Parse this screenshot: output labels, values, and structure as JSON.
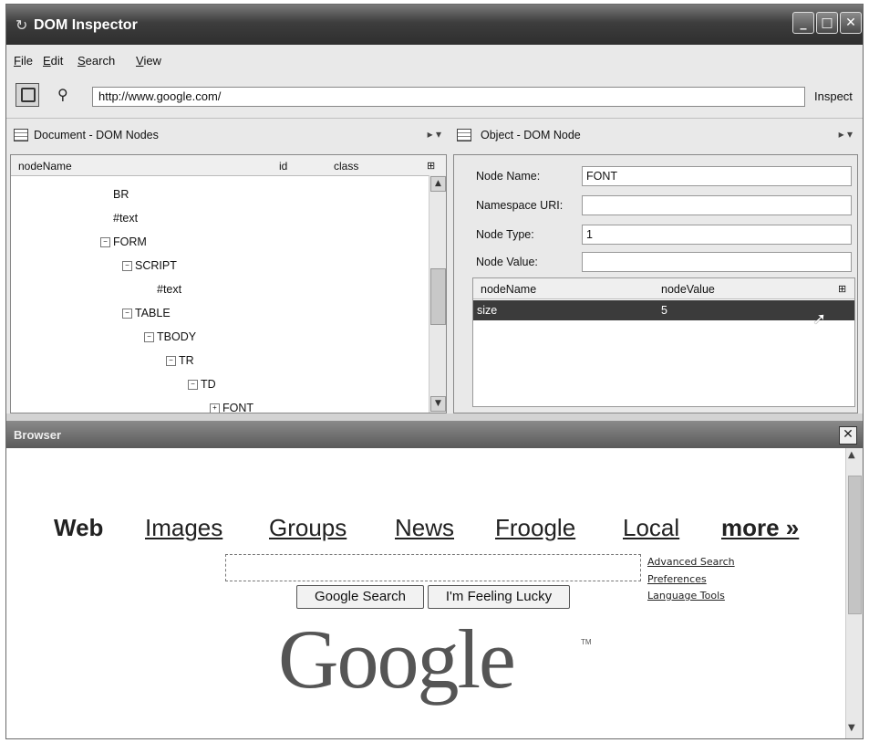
{
  "window": {
    "title": "DOM Inspector",
    "title_icon": "refresh-icon",
    "buttons": [
      "minimize",
      "maximize",
      "close"
    ]
  },
  "menu": [
    {
      "key": "F",
      "rest": "ile"
    },
    {
      "key": "E",
      "rest": "dit"
    },
    {
      "key": "S",
      "rest": "earch"
    },
    {
      "key": "V",
      "rest": "iew"
    }
  ],
  "toolbar": {
    "url": "http://www.google.com/",
    "inspect_label": "Inspect"
  },
  "left_pane": {
    "title": "Document - DOM Nodes",
    "columns": [
      "nodeName",
      "id",
      "class"
    ],
    "nodes": [
      {
        "label": "BR",
        "toggle": ""
      },
      {
        "label": "#text",
        "toggle": ""
      },
      {
        "label": "FORM",
        "toggle": "−"
      },
      {
        "label": "SCRIPT",
        "toggle": "−"
      },
      {
        "label": "#text",
        "toggle": ""
      },
      {
        "label": "TABLE",
        "toggle": "−"
      },
      {
        "label": "TBODY",
        "toggle": "−"
      },
      {
        "label": "TR",
        "toggle": "−"
      },
      {
        "label": "TD",
        "toggle": "−"
      },
      {
        "label": "FONT",
        "toggle": "+"
      }
    ]
  },
  "right_pane": {
    "title": "Object - DOM Node",
    "fields": [
      {
        "label": "Node Name:",
        "value": "FONT"
      },
      {
        "label": "Namespace URI:",
        "value": ""
      },
      {
        "label": "Node Type:",
        "value": "1"
      },
      {
        "label": "Node Value:",
        "value": ""
      }
    ],
    "attr_columns": [
      "nodeName",
      "nodeValue"
    ],
    "attr_rows": [
      {
        "name": "size",
        "value": "5"
      }
    ]
  },
  "browser": {
    "title": "Browser",
    "tabs": [
      "Web",
      "Images",
      "Groups",
      "News",
      "Froogle",
      "Local",
      "more »"
    ],
    "search_value": "",
    "buttons": [
      "Google Search",
      "I'm Feeling Lucky"
    ],
    "side_links": [
      "Advanced Search",
      "Preferences",
      "Language Tools"
    ],
    "logo": "Google",
    "logo_tm": "TM"
  }
}
